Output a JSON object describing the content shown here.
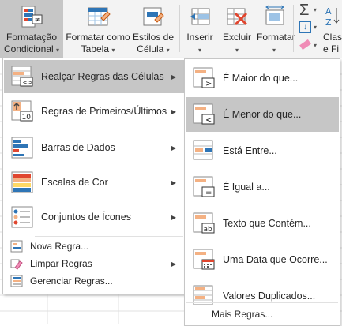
{
  "ribbon": {
    "cond_format": {
      "line1": "Formatação",
      "line2": "Condicional"
    },
    "format_table": {
      "line1": "Formatar como",
      "line2": "Tabela"
    },
    "cell_styles": {
      "line1": "Estilos de",
      "line2": "Célula"
    },
    "insert": {
      "line1": "Inserir"
    },
    "delete": {
      "line1": "Excluir"
    },
    "format": {
      "line1": "Formatar"
    },
    "clear_partial": {
      "line1": "Clas",
      "line2": "e Fi"
    }
  },
  "menu_main": {
    "items": [
      {
        "label": "Realçar Regras das Células",
        "icon": "highlight-cells-rules-icon",
        "submenu": true,
        "highlighted": true
      },
      {
        "label": "Regras de Primeiros/Últimos",
        "icon": "top-bottom-rules-icon",
        "submenu": true
      },
      {
        "label": "Barras de Dados",
        "icon": "data-bars-icon",
        "submenu": true
      },
      {
        "label": "Escalas de Cor",
        "icon": "color-scales-icon",
        "submenu": true
      },
      {
        "label": "Conjuntos de Ícones",
        "icon": "icon-sets-icon",
        "submenu": true
      }
    ],
    "small_items": [
      {
        "label": "Nova Regra...",
        "icon": "new-rule-icon"
      },
      {
        "label": "Limpar Regras",
        "icon": "clear-rules-icon",
        "submenu": true
      },
      {
        "label": "Gerenciar Regras...",
        "icon": "manage-rules-icon"
      }
    ]
  },
  "menu_sub": {
    "items": [
      {
        "label": "É Maior do que...",
        "icon": "greater-than-icon"
      },
      {
        "label": "É Menor do que...",
        "icon": "less-than-icon",
        "highlighted": true
      },
      {
        "label": "Está Entre...",
        "icon": "between-icon"
      },
      {
        "label": "É Igual a...",
        "icon": "equal-to-icon"
      },
      {
        "label": "Texto que Contém...",
        "icon": "text-contains-icon"
      },
      {
        "label": "Uma Data que Ocorre...",
        "icon": "date-occurring-icon"
      },
      {
        "label": "Valores Duplicados...",
        "icon": "duplicate-values-icon"
      }
    ],
    "more": "Mais Regras..."
  },
  "colors": {
    "highlight": "#c6c6c6",
    "ribbon": "#f3f3f3",
    "border": "#c6c6c6",
    "accent_blue": "#2e75b6",
    "accent_orange": "#f4b183",
    "accent_red": "#e0462f"
  }
}
